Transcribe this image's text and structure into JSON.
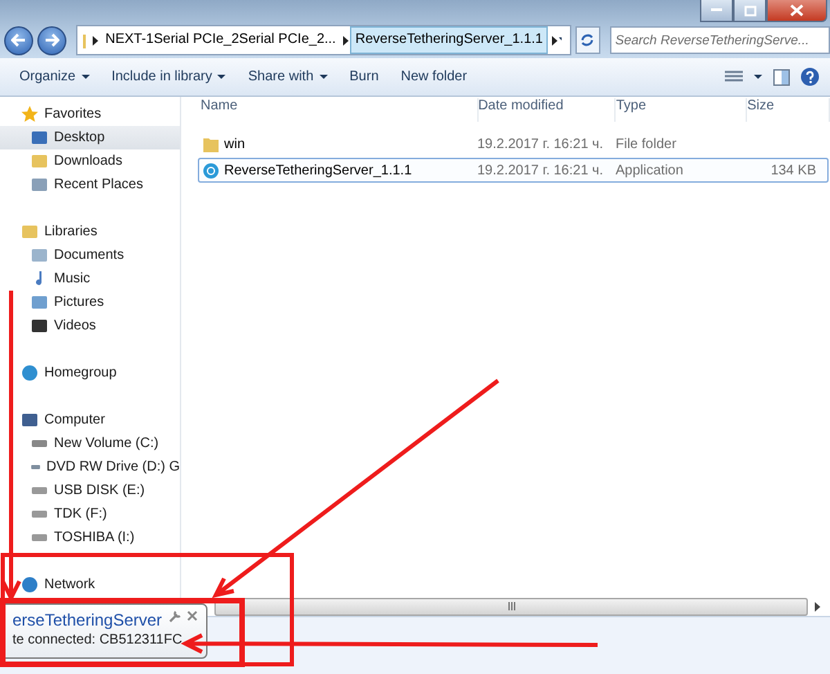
{
  "address": {
    "crumbs": [
      {
        "label": "NEXT-1Serial PCIe_2Serial PCIe_2...",
        "selected": false
      },
      {
        "label": "ReverseTetheringServer_1.1.1",
        "selected": true
      }
    ]
  },
  "search": {
    "placeholder": "Search ReverseTetheringServe..."
  },
  "toolbar": [
    {
      "label": "Organize",
      "dropdown": true
    },
    {
      "label": "Include in library",
      "dropdown": true
    },
    {
      "label": "Share with",
      "dropdown": true
    },
    {
      "label": "Burn",
      "dropdown": false
    },
    {
      "label": "New folder",
      "dropdown": false
    }
  ],
  "sidebar": [
    {
      "label": "Favorites",
      "kind": "star",
      "selected": false,
      "children": [
        {
          "label": "Desktop",
          "kind": "desktop",
          "selected": true
        },
        {
          "label": "Downloads",
          "kind": "folder",
          "selected": false
        },
        {
          "label": "Recent Places",
          "kind": "recent",
          "selected": false
        }
      ]
    },
    {
      "label": "Libraries",
      "kind": "library",
      "selected": false,
      "children": [
        {
          "label": "Documents",
          "kind": "doc",
          "selected": false
        },
        {
          "label": "Music",
          "kind": "music",
          "selected": false
        },
        {
          "label": "Pictures",
          "kind": "picture",
          "selected": false
        },
        {
          "label": "Videos",
          "kind": "video",
          "selected": false
        }
      ]
    },
    {
      "label": "Homegroup",
      "kind": "homegroup",
      "selected": false
    },
    {
      "label": "Computer",
      "kind": "computer",
      "selected": false,
      "children": [
        {
          "label": "New Volume (C:)",
          "kind": "drive",
          "selected": false
        },
        {
          "label": "DVD RW Drive (D:) G",
          "kind": "dvd",
          "selected": false
        },
        {
          "label": "USB DISK (E:)",
          "kind": "usb",
          "selected": false
        },
        {
          "label": "TDK (F:)",
          "kind": "usb",
          "selected": false
        },
        {
          "label": "TOSHIBA (I:)",
          "kind": "usb",
          "selected": false
        }
      ]
    },
    {
      "label": "Network",
      "kind": "network",
      "selected": false
    }
  ],
  "columns": [
    "Name",
    "Date modified",
    "Type",
    "Size"
  ],
  "files": [
    {
      "kind": "folder",
      "name": "win",
      "date": "19.2.2017 г. 16:21 ч.",
      "type": "File folder",
      "selected": false
    },
    {
      "kind": "app",
      "name": "ReverseTetheringServer_1.1.1",
      "date": "19.2.2017 г. 16:21 ч.",
      "type": "Application",
      "size": "134 KB",
      "selected": true
    }
  ],
  "notification": {
    "title": "erseTetheringServer",
    "message": "te connected: CB512311FC"
  }
}
